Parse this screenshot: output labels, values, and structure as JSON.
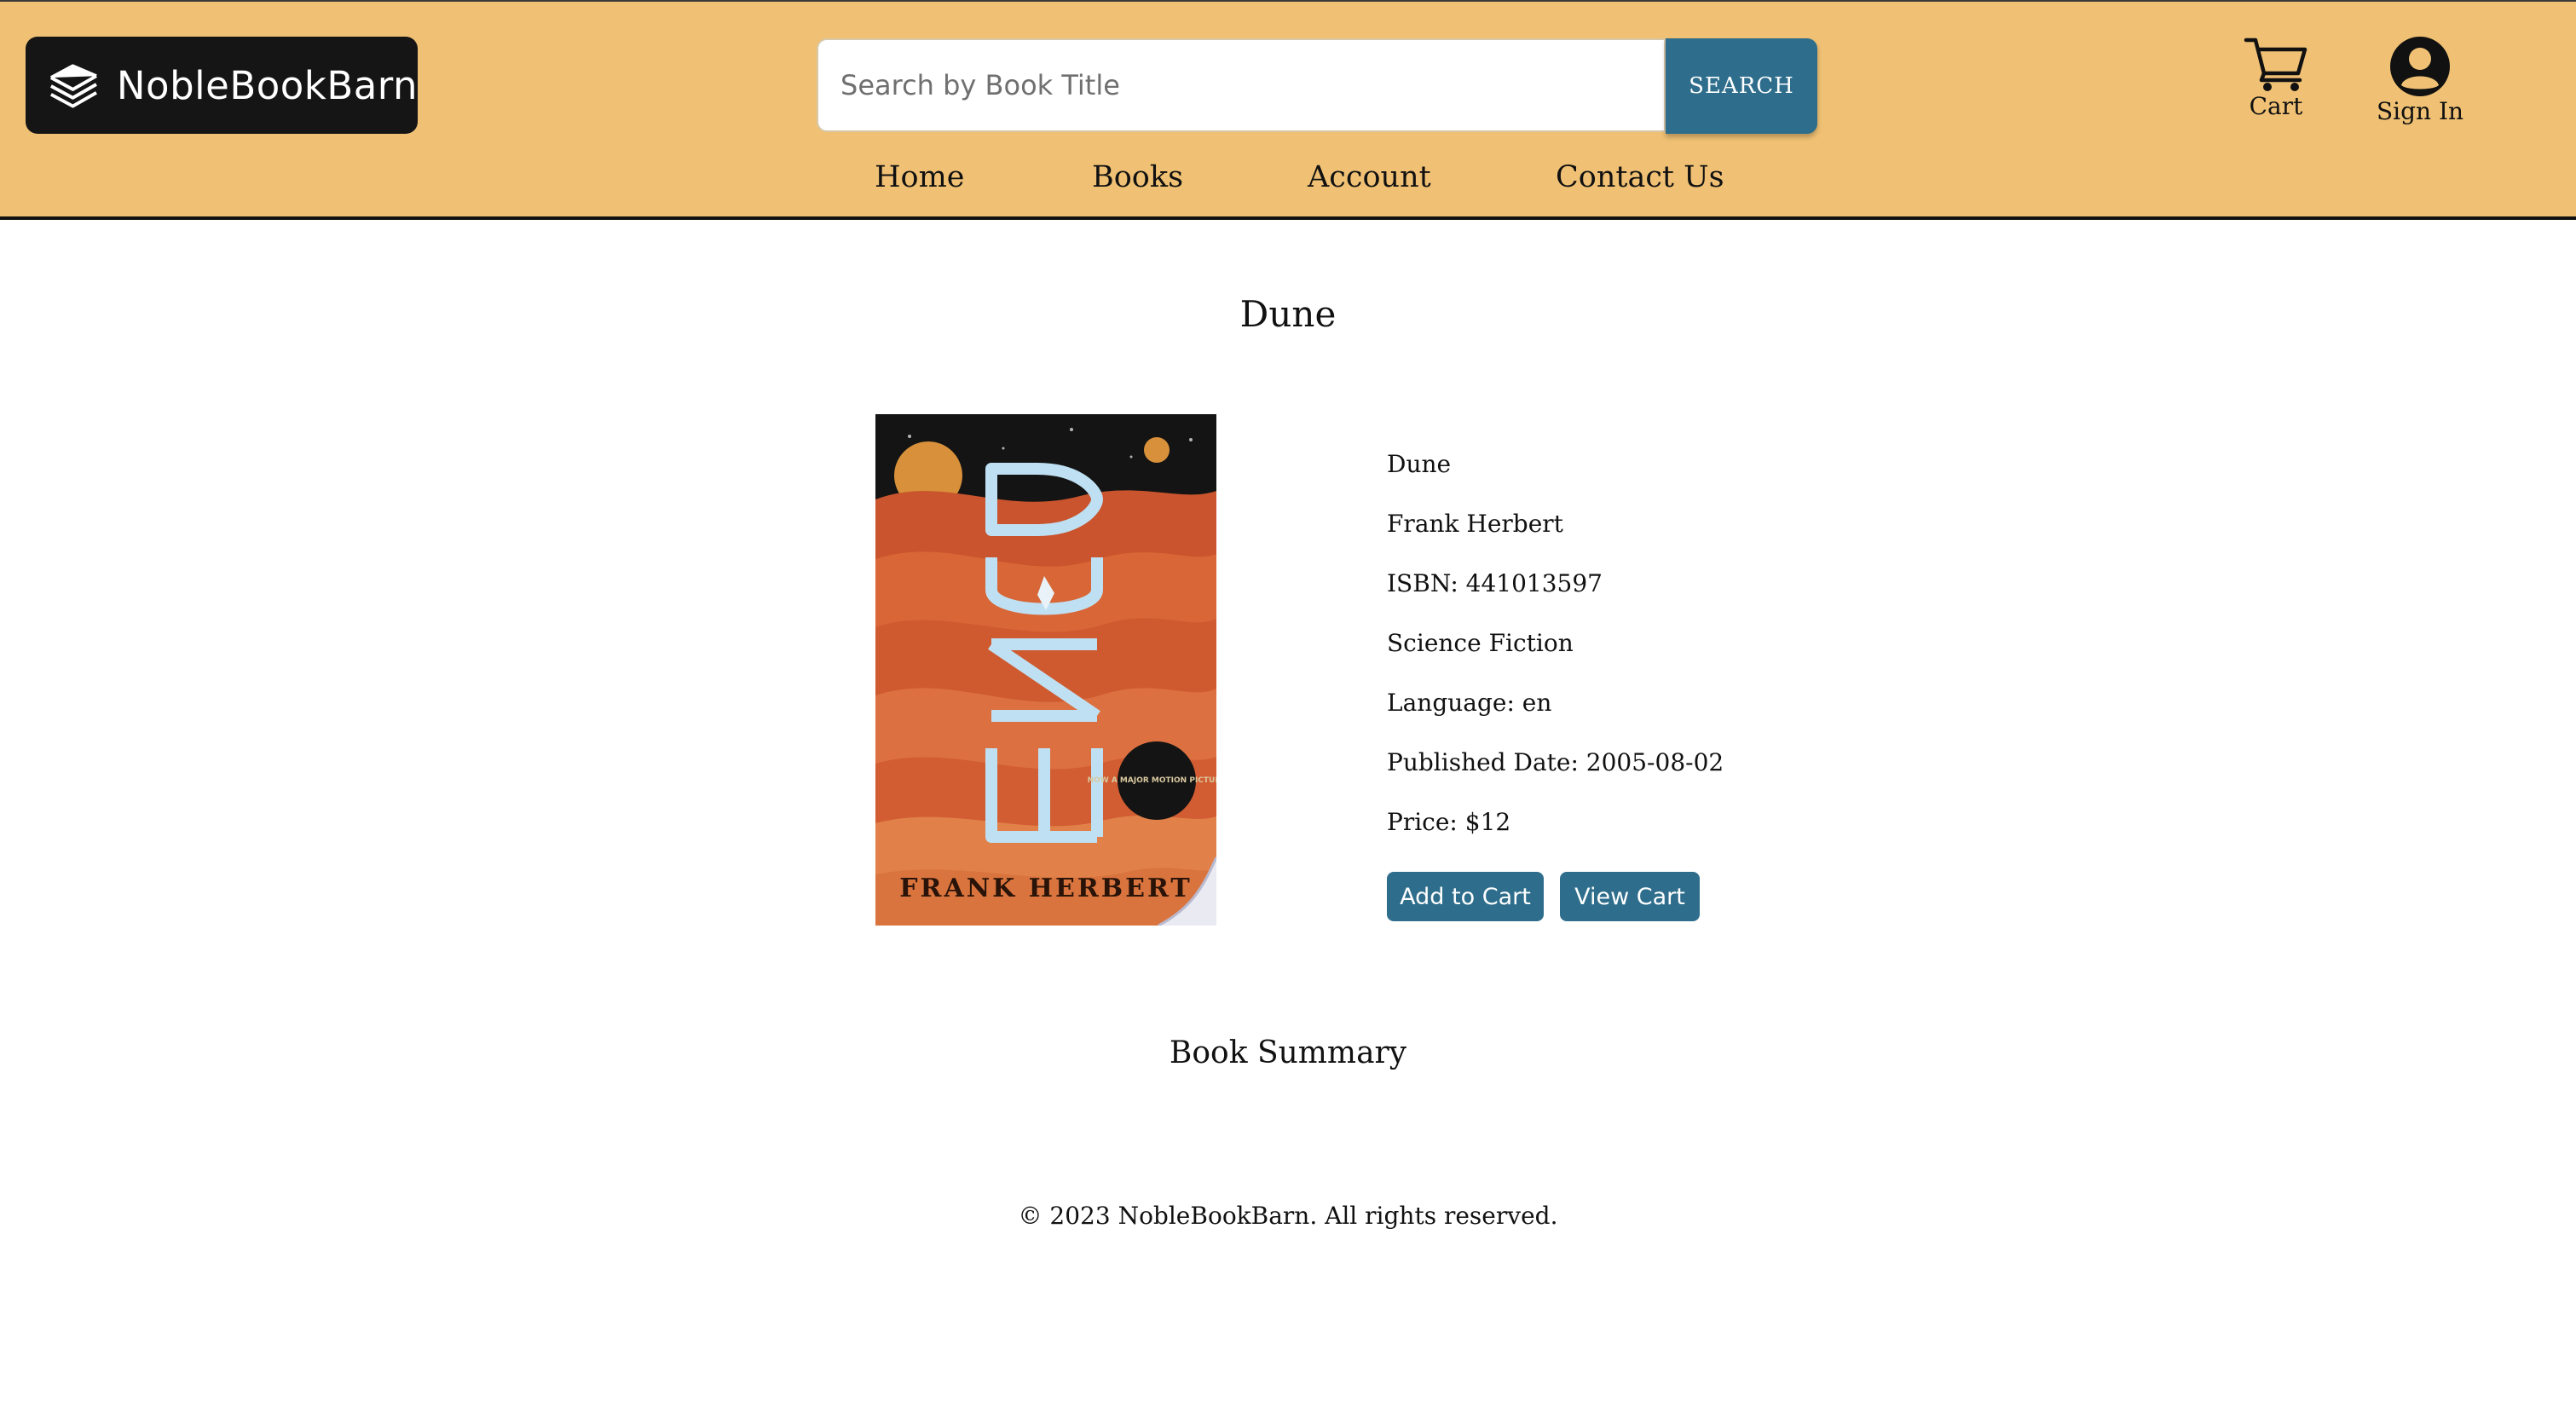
{
  "header": {
    "logo_text": "NobleBookBarn",
    "search_placeholder": "Search by Book Title",
    "search_button": "SEARCH",
    "cart_label": "Cart",
    "signin_label": "Sign In",
    "nav": [
      "Home",
      "Books",
      "Account",
      "Contact Us"
    ]
  },
  "book": {
    "page_title": "Dune",
    "cover_title": "DUNE",
    "cover_author": "FRANK HERBERT",
    "cover_badge": "NOW A MAJOR MOTION PICTURE",
    "title": "Dune",
    "author": "Frank Herbert",
    "isbn": "ISBN: 441013597",
    "genre": "Science Fiction",
    "language": "Language: en",
    "published": "Published Date: 2005-08-02",
    "price": "Price: $12",
    "add_to_cart": "Add to Cart",
    "view_cart": "View Cart"
  },
  "summary_heading": "Book Summary",
  "footer": "© 2023 NobleBookBarn. All rights reserved.",
  "colors": {
    "header_bg": "#f0c174",
    "accent": "#2e6e8c",
    "logo_bg": "#151515"
  }
}
